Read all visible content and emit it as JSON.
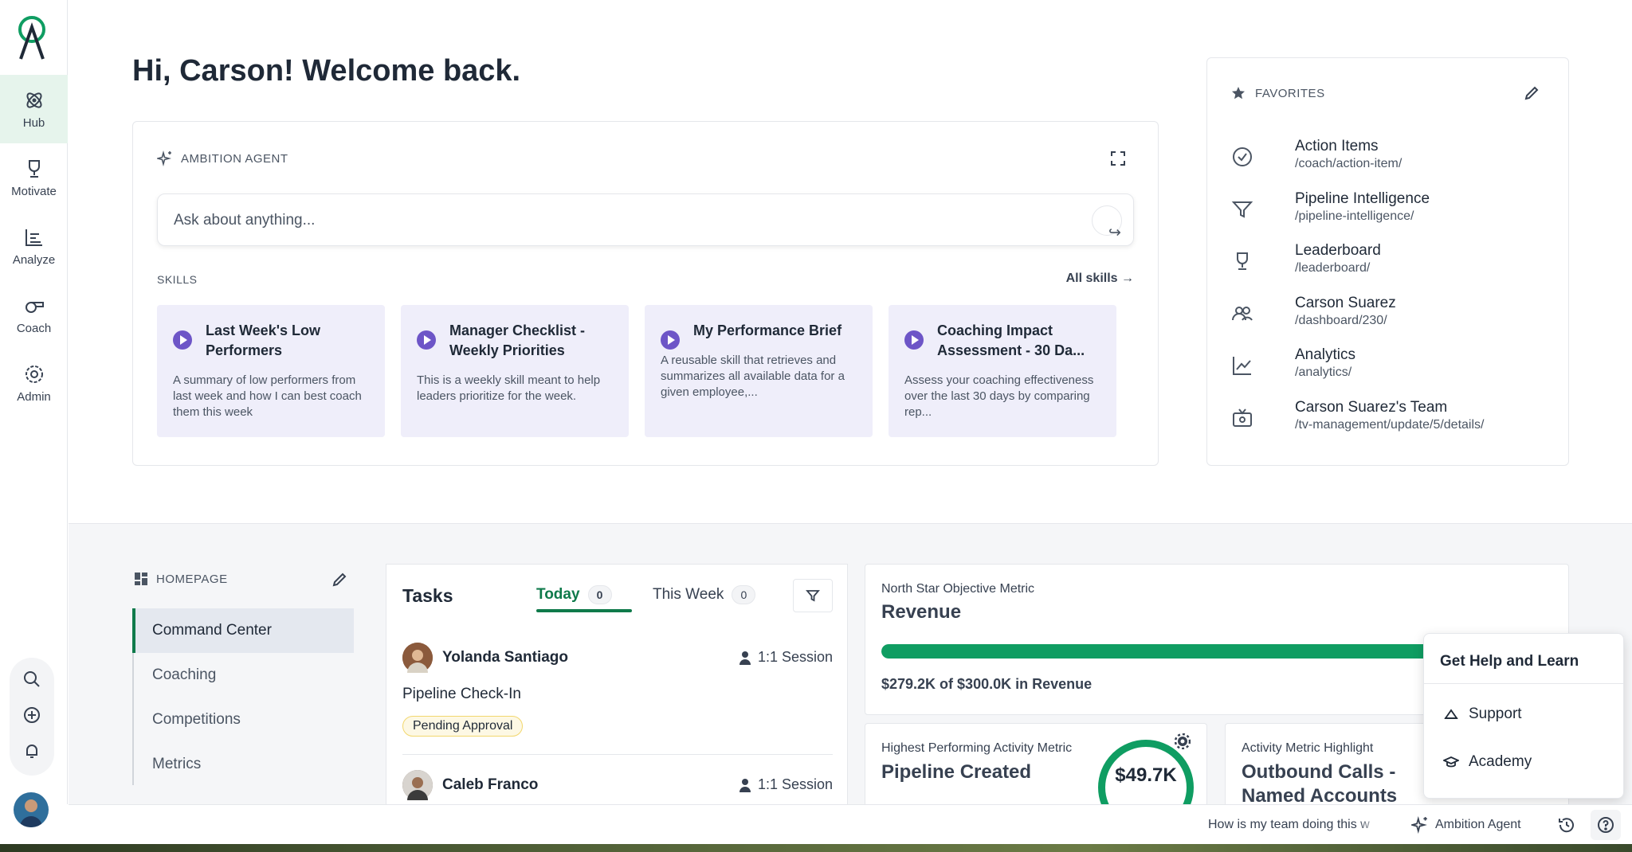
{
  "sidebar": {
    "items": [
      {
        "label": "Hub",
        "icon": "atom-icon",
        "active": true
      },
      {
        "label": "Motivate",
        "icon": "trophy-icon"
      },
      {
        "label": "Analyze",
        "icon": "bar-chart-icon"
      },
      {
        "label": "Coach",
        "icon": "whistle-icon"
      },
      {
        "label": "Admin",
        "icon": "gear-icon"
      }
    ],
    "tools": [
      "search-icon",
      "plus-circle-icon",
      "bell-icon"
    ]
  },
  "greeting": "Hi, Carson! Welcome back.",
  "agent": {
    "title": "AMBITION AGENT",
    "placeholder": "Ask about anything...",
    "skills_label": "SKILLS",
    "all_skills": "All skills",
    "skills": [
      {
        "title": "Last Week's Low Performers",
        "desc": "A summary of low performers from last week and how I can best coach them this week"
      },
      {
        "title": "Manager Checklist - Weekly Priorities",
        "desc": "This is a weekly skill meant to help leaders prioritize for the week."
      },
      {
        "title": "My Performance Brief",
        "desc": "A reusable skill that retrieves and summarizes all available data for a given employee,..."
      },
      {
        "title": "Coaching Impact Assessment - 30 Da...",
        "desc": "Assess your coaching effectiveness over the last 30 days by comparing rep..."
      }
    ]
  },
  "favorites": {
    "title": "FAVORITES",
    "items": [
      {
        "name": "Action Items",
        "path": "/coach/action-item/",
        "icon": "check-circle-icon"
      },
      {
        "name": "Pipeline Intelligence",
        "path": "/pipeline-intelligence/",
        "icon": "filter-icon"
      },
      {
        "name": "Leaderboard",
        "path": "/leaderboard/",
        "icon": "trophy-icon"
      },
      {
        "name": "Carson Suarez",
        "path": "/dashboard/230/",
        "icon": "users-icon"
      },
      {
        "name": "Analytics",
        "path": "/analytics/",
        "icon": "line-chart-icon"
      },
      {
        "name": "Carson Suarez's Team",
        "path": "/tv-management/update/5/details/",
        "icon": "tv-icon"
      }
    ]
  },
  "homepage": {
    "label": "HOMEPAGE",
    "items": [
      "Command Center",
      "Coaching",
      "Competitions",
      "Metrics"
    ]
  },
  "tasks": {
    "title": "Tasks",
    "tab_today": "Today",
    "tab_today_count": "0",
    "tab_week": "This Week",
    "tab_week_count": "0",
    "items": [
      {
        "name": "Yolanda Santiago",
        "session": "1:1 Session",
        "title": "Pipeline Check-In",
        "badge": "Pending Approval"
      },
      {
        "name": "Caleb Franco",
        "session": "1:1 Session"
      }
    ]
  },
  "north_star": {
    "label": "North Star Objective Metric",
    "title": "Revenue",
    "progress": 0.93,
    "summary": "$279.2K of $300.0K in Revenue"
  },
  "metric1": {
    "label": "Highest Performing Activity Metric",
    "title": "Pipeline Created",
    "value": "$49.7K"
  },
  "metric2": {
    "label": "Activity Metric Highlight",
    "title": "Outbound Calls - Named Accounts"
  },
  "help": {
    "title": "Get Help and Learn",
    "items": [
      "Support",
      "Academy"
    ]
  },
  "statusbar": {
    "question": "How is my team doing this w",
    "agent": "Ambition Agent"
  },
  "colors": {
    "brand": "#0f7a4b",
    "accent": "#6d55c7"
  }
}
